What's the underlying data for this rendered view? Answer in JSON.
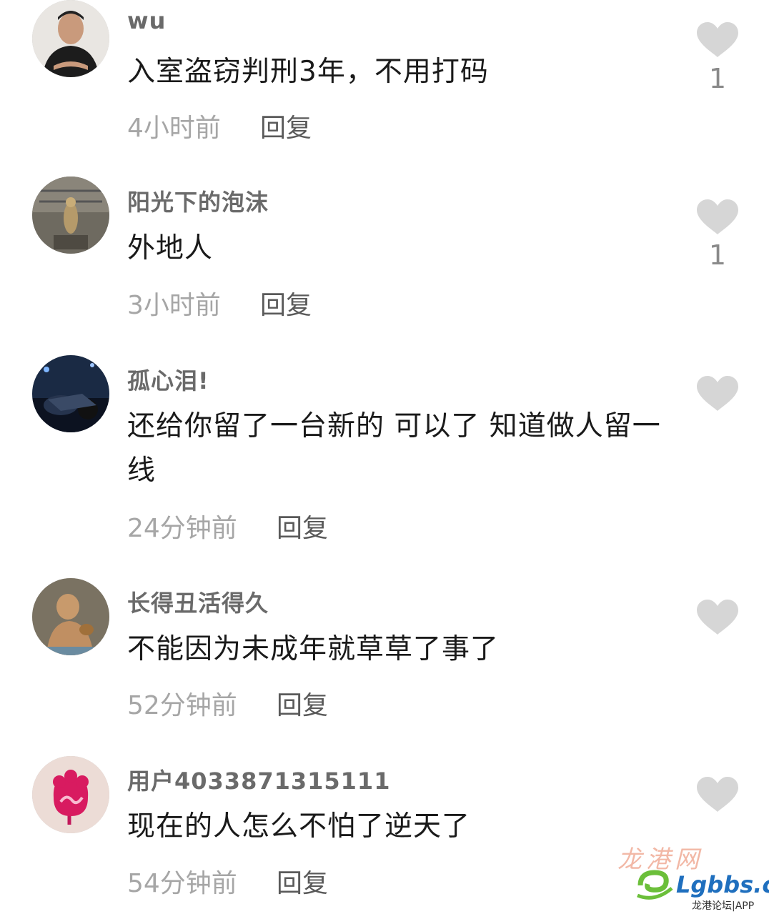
{
  "comments": [
    {
      "username": "wu",
      "text": "入室盗窃判刑3年，不用打码",
      "time": "4小时前",
      "reply": "回复",
      "likes": "1"
    },
    {
      "username": "阳光下的泡沫",
      "text": "外地人",
      "time": "3小时前",
      "reply": "回复",
      "likes": "1"
    },
    {
      "username": "孤心泪!",
      "text": "还给你留了一台新的 可以了 知道做人留一线",
      "time": "24分钟前",
      "reply": "回复",
      "likes": ""
    },
    {
      "username": "长得丑活得久",
      "text": "不能因为未成年就草草了事了",
      "time": "52分钟前",
      "reply": "回复",
      "likes": ""
    },
    {
      "username": "用户4033871315111",
      "text": "现在的人怎么不怕了逆天了",
      "time": "54分钟前",
      "reply": "回复",
      "likes": ""
    }
  ],
  "icons": {
    "like": "heart-icon"
  },
  "colors": {
    "like_icon": "#d6d6d6",
    "username": "#6a6a6a",
    "time": "#a6a6a6"
  },
  "watermark": {
    "name": "龙港网",
    "site": "Lgbbs.cn",
    "subtitle": "龙港论坛|APP"
  }
}
